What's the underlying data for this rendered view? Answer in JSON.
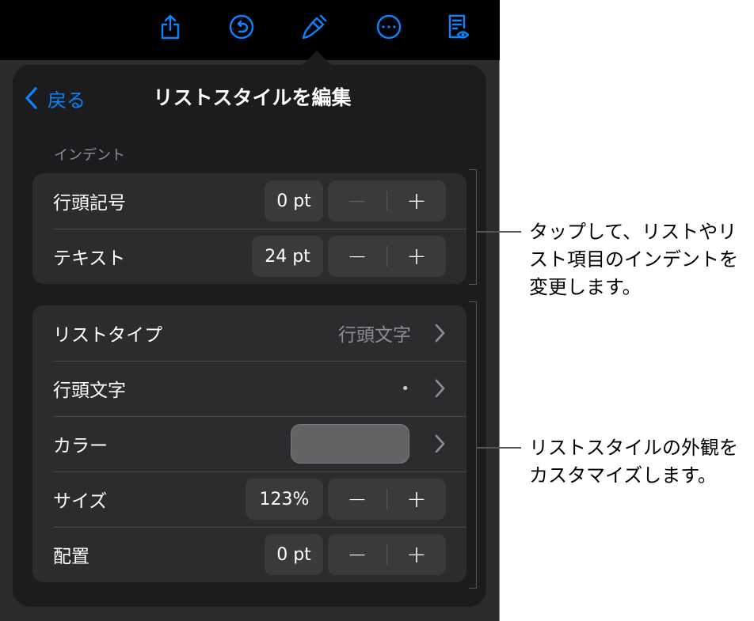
{
  "toolbar": {
    "icons": [
      "share-icon",
      "undo-icon",
      "format-brush-icon",
      "more-icon",
      "reading-view-icon"
    ],
    "accent": "#0a84ff"
  },
  "popover": {
    "back_label": "戻る",
    "title": "リストスタイルを編集",
    "section_indent": "インデント",
    "indent_rows": [
      {
        "label": "行頭記号",
        "value": "0 pt"
      },
      {
        "label": "テキスト",
        "value": "24 pt"
      }
    ],
    "style_rows": {
      "list_type": {
        "label": "リストタイプ",
        "value": "行頭文字"
      },
      "bullet": {
        "label": "行頭文字",
        "value": "•"
      },
      "color": {
        "label": "カラー",
        "swatch": "#636366"
      },
      "size": {
        "label": "サイズ",
        "value": "123%"
      },
      "alignment": {
        "label": "配置",
        "value": "0 pt"
      }
    },
    "stepper": {
      "minus": "−",
      "plus": "+"
    }
  },
  "callouts": {
    "indent": [
      "タップして、リストやリ",
      "スト項目のインデントを",
      "変更します。"
    ],
    "style": [
      "リストスタイルの外観を",
      "カスタマイズします。"
    ]
  }
}
